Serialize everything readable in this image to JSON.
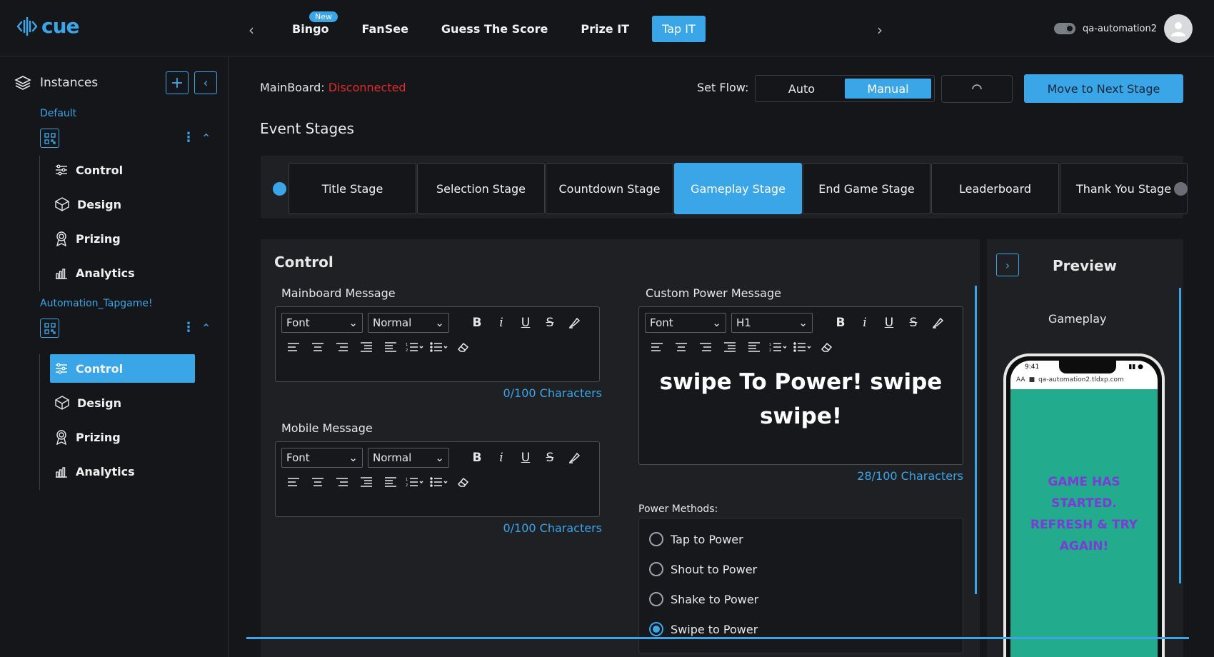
{
  "app": {
    "logo_text": "cue",
    "brand_color": "#3aa6e8",
    "status_color": "#e22b2b"
  },
  "nav": {
    "tabs": [
      {
        "label": "Bingo",
        "badge": "New"
      },
      {
        "label": "FanSee"
      },
      {
        "label": "Guess The Score"
      },
      {
        "label": "Prize IT"
      },
      {
        "label": "Tap IT",
        "active": true
      }
    ],
    "username": "qa-automation2"
  },
  "sidebar": {
    "title": "Instances",
    "groups": [
      {
        "name": "Default",
        "items": [
          "Control",
          "Design",
          "Prizing",
          "Analytics"
        ],
        "active_item": null
      },
      {
        "name": "Automation_Tapgame!",
        "items": [
          "Control",
          "Design",
          "Prizing",
          "Analytics"
        ],
        "active_item": "Control"
      }
    ]
  },
  "header": {
    "mainboard_label": "MainBoard:",
    "mainboard_status": "Disconnected",
    "set_flow_label": "Set Flow:",
    "flow_options": [
      "Auto",
      "Manual"
    ],
    "flow_selected": "Manual",
    "next_button": "Move to Next Stage"
  },
  "stages": {
    "title": "Event Stages",
    "items": [
      "Title Stage",
      "Selection Stage",
      "Countdown Stage",
      "Gameplay Stage",
      "End Game Stage",
      "Leaderboard",
      "Thank You Stage"
    ],
    "active": "Gameplay Stage"
  },
  "control": {
    "title": "Control",
    "mainboard_message": {
      "label": "Mainboard Message",
      "font": "Font",
      "size": "Normal",
      "chars": "0/100 Characters"
    },
    "mobile_message": {
      "label": "Mobile Message",
      "font": "Font",
      "size": "Normal",
      "chars": "0/100 Characters"
    },
    "custom_power": {
      "label": "Custom Power Message",
      "font": "Font",
      "size": "H1",
      "text": "swipe To Power! swipe swipe!",
      "chars": "28/100 Characters"
    },
    "power_methods": {
      "label": "Power Methods:",
      "options": [
        "Tap to Power",
        "Shout to Power",
        "Shake to Power",
        "Swipe to Power"
      ],
      "selected": "Swipe to Power"
    }
  },
  "preview": {
    "title": "Preview",
    "subtitle": "Gameplay",
    "phone_time": "9:41",
    "phone_url": "qa-automation2.tldxp.com",
    "phone_url_prefix": "AA",
    "game_message": "GAME HAS STARTED. REFRESH & TRY AGAIN!"
  }
}
